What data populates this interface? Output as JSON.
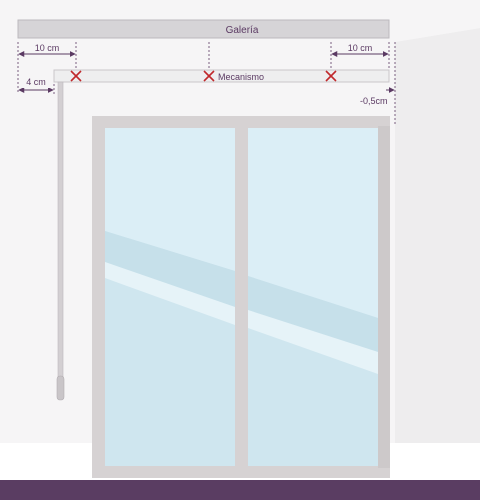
{
  "labels": {
    "galeria": "Galería",
    "mecanismo": "Mecanismo",
    "left_offset": "10 cm",
    "right_offset": "10 cm",
    "cord_offset": "4 cm",
    "end_offset": "-0,5cm"
  },
  "colors": {
    "accent": "#5b3a63",
    "mark": "#c0282b",
    "glass": "#d5ebf3",
    "frame": "#d6d2d3",
    "footer": "#5a3d62"
  },
  "icons": {
    "fixing_point": "cross-mark-icon"
  }
}
